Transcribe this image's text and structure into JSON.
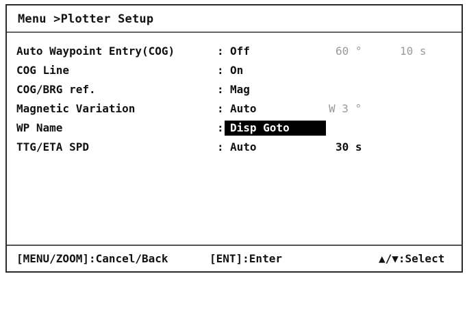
{
  "header": {
    "title": "Menu >Plotter Setup"
  },
  "settings": [
    {
      "label": "Auto Waypoint Entry(COG)",
      "colon": ":",
      "value": "Off",
      "extra1": "60 °",
      "extra2": "10 s"
    },
    {
      "label": "COG Line",
      "colon": ":",
      "value": "On"
    },
    {
      "label": "COG/BRG ref.",
      "colon": ":",
      "value": "Mag"
    },
    {
      "label": "Magnetic Variation",
      "colon": ":",
      "value": "Auto",
      "extra1": "W 3 °"
    },
    {
      "label": "WP Name",
      "colon": ":",
      "value": "Disp Goto",
      "selected": true
    },
    {
      "label": "TTG/ETA SPD",
      "colon": ":",
      "value": "Auto",
      "extra1": "30 s"
    }
  ],
  "footer": {
    "cancel_hint": "[MENU/ZOOM]:Cancel/Back",
    "enter_hint": "[ENT]:Enter",
    "select_hint": "▲/▼:Select"
  },
  "colors": {
    "text": "#111111",
    "dim_text": "#9a9a9a",
    "highlight_bg": "#000000",
    "highlight_text": "#ffffff"
  }
}
